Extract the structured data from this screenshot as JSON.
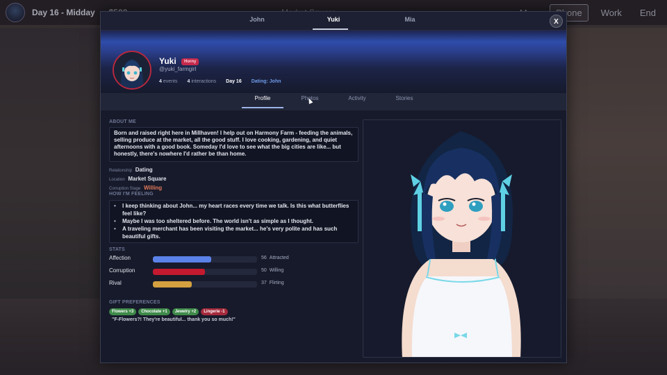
{
  "topbar": {
    "day": "Day 16 - Midday",
    "money": "$500",
    "location": "Market Square",
    "buttons": [
      "Map",
      "Phone",
      "Work",
      "End"
    ]
  },
  "modal": {
    "char_tabs": [
      "John",
      "Yuki",
      "Mia"
    ],
    "active_char_tab": "Yuki",
    "close_label": "X",
    "profile": {
      "name": "Yuki",
      "mood": "Horny",
      "handle": "@yuki_farmgirl",
      "events_count": "4",
      "events_label": "events",
      "interactions_count": "4",
      "interactions_label": "interactions",
      "day": "Day 16",
      "dating": "Dating: John"
    },
    "sub_tabs": [
      "Profile",
      "Photos",
      "Activity",
      "Stories"
    ],
    "about": {
      "title": "ABOUT ME",
      "text": "Born and raised right here in Millhaven! I help out on Harmony Farm - feeding the animals, selling produce at the market, all the good stuff. I love cooking, gardening, and quiet afternoons with a good book. Someday I'd love to see what the big cities are like... but honestly, there's nowhere I'd rather be than home."
    },
    "info": {
      "relationship_label": "Relationship",
      "relationship": "Dating",
      "location_label": "Location",
      "location": "Market Square",
      "corruption_stage_label": "Corruption Stage",
      "corruption_stage": "Willing"
    },
    "feeling": {
      "title": "HOW I'M FEELING",
      "items": [
        "I keep thinking about John... my heart races every time we talk. Is this what butterflies feel like?",
        "Maybe I was too sheltered before. The world isn't as simple as I thought.",
        "A traveling merchant has been visiting the market... he's very polite and has such beautiful gifts."
      ]
    },
    "stats": {
      "title": "STATS",
      "items": [
        {
          "label": "Affection",
          "value": 56,
          "value_text": "56",
          "status": "Attracted",
          "color": "#5b82e8"
        },
        {
          "label": "Corruption",
          "value": 50,
          "value_text": "50",
          "status": "Willing",
          "color": "#c4192e"
        },
        {
          "label": "Rival",
          "value": 37,
          "value_text": "37",
          "status": "Flirting",
          "color": "#d4a040"
        }
      ]
    },
    "gifts": {
      "title": "GIFT PREFERENCES",
      "items": [
        {
          "label": "Flowers +3",
          "kind": "pos"
        },
        {
          "label": "Chocolate +1",
          "kind": "pos"
        },
        {
          "label": "Jewelry +2",
          "kind": "pos"
        },
        {
          "label": "Lingerie -1",
          "kind": "neg"
        }
      ],
      "quote": "\"F-Flowers?! They're beautiful... thank you so much!\""
    }
  }
}
